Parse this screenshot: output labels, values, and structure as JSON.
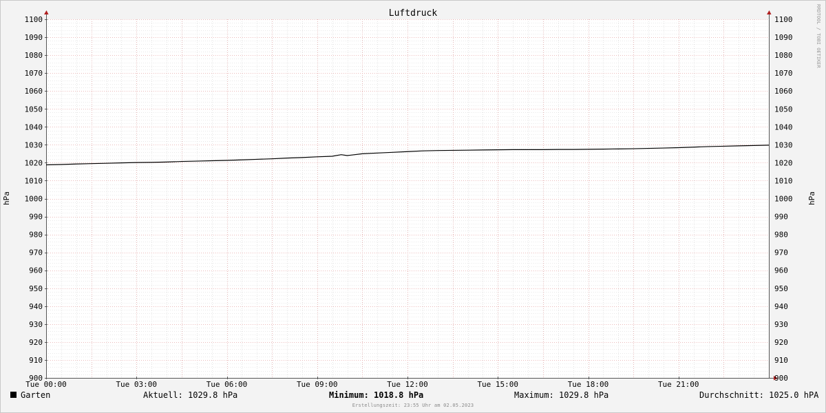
{
  "chart_data": {
    "type": "line",
    "title": "Luftdruck",
    "ylabel_left": "hPa",
    "ylabel_right": "hPa",
    "ylim": [
      900,
      1100
    ],
    "yticks": [
      900,
      910,
      920,
      930,
      940,
      950,
      960,
      970,
      980,
      990,
      1000,
      1010,
      1020,
      1030,
      1040,
      1050,
      1060,
      1070,
      1080,
      1090,
      1100
    ],
    "xlim_hours": [
      0,
      24
    ],
    "xticks": [
      {
        "h": 0,
        "label": "Tue 00:00"
      },
      {
        "h": 3,
        "label": "Tue 03:00"
      },
      {
        "h": 6,
        "label": "Tue 06:00"
      },
      {
        "h": 9,
        "label": "Tue 09:00"
      },
      {
        "h": 12,
        "label": "Tue 12:00"
      },
      {
        "h": 15,
        "label": "Tue 15:00"
      },
      {
        "h": 18,
        "label": "Tue 18:00"
      },
      {
        "h": 21,
        "label": "Tue 21:00"
      }
    ],
    "grid": true,
    "series": [
      {
        "name": "Garten",
        "color": "#000000",
        "x": [
          0,
          0.5,
          1,
          1.5,
          2,
          2.5,
          3,
          3.5,
          4,
          4.5,
          5,
          5.5,
          6,
          6.5,
          7,
          7.5,
          8,
          8.5,
          9,
          9.5,
          9.8,
          10,
          10.5,
          11,
          11.5,
          12,
          12.5,
          13,
          13.5,
          14,
          14.5,
          15,
          15.5,
          16,
          16.5,
          17,
          17.5,
          18,
          18.5,
          19,
          19.5,
          20,
          20.5,
          21,
          21.5,
          22,
          22.5,
          23,
          23.5,
          24
        ],
        "y": [
          1018.8,
          1019.0,
          1019.3,
          1019.5,
          1019.7,
          1019.9,
          1020.1,
          1020.2,
          1020.4,
          1020.7,
          1020.9,
          1021.1,
          1021.3,
          1021.6,
          1021.9,
          1022.2,
          1022.6,
          1022.9,
          1023.3,
          1023.6,
          1024.5,
          1024.0,
          1025.0,
          1025.4,
          1025.8,
          1026.2,
          1026.6,
          1026.8,
          1026.9,
          1027.0,
          1027.1,
          1027.2,
          1027.3,
          1027.3,
          1027.3,
          1027.4,
          1027.4,
          1027.5,
          1027.6,
          1027.7,
          1027.8,
          1028.0,
          1028.2,
          1028.4,
          1028.7,
          1029.0,
          1029.2,
          1029.4,
          1029.6,
          1029.8
        ]
      }
    ]
  },
  "legend": {
    "series_name": "Garten",
    "current": "Aktuell: 1029.8 hPa",
    "minimum_label": "Minimum:",
    "minimum_value": "1018.8 hPa",
    "maximum": "Maximum: 1029.8 hPa",
    "average": "Durchschnitt: 1025.0 hPA"
  },
  "footer": "Erstellungszeit: 23:55 Uhr am 02.05.2023",
  "side_credit": "RRDTOOL / TOBI OETIKER",
  "colors": {
    "background": "#f3f3f3",
    "plot_background": "#ffffff",
    "major_grid": "#e5a3a3",
    "minor_grid": "#d2d2d2",
    "axis": "#555555",
    "arrow": "#b02020"
  }
}
